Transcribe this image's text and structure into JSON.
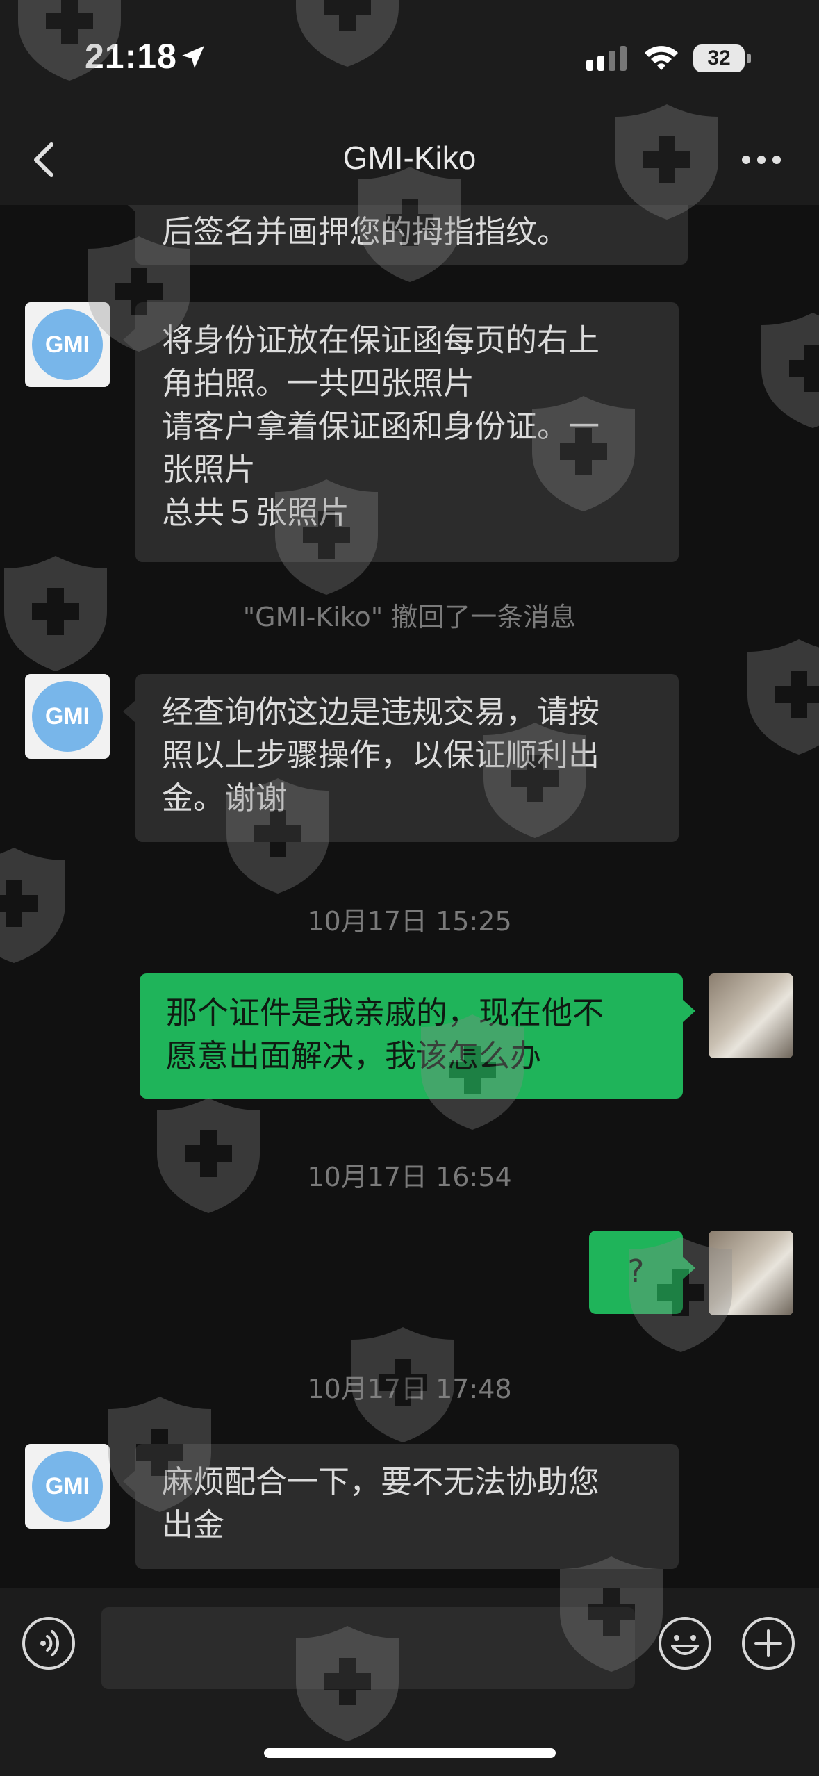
{
  "status": {
    "time": "21:18",
    "battery": "32"
  },
  "nav": {
    "title": "GMI-Kiko"
  },
  "messages": [
    {
      "lines": [
        "后签名并画押您的拇指指纹。"
      ]
    },
    {
      "avatar": "GMI",
      "lines": [
        "将身份证放在保证函每页的右上",
        "角拍照。一共四张照片",
        "请客户拿着保证函和身份证。一",
        "张照片",
        "总共５张照片"
      ]
    },
    {
      "avatar": "GMI",
      "lines": [
        "经查询你这边是违规交易，请按",
        "照以上步骤操作，以保证顺利出",
        "金。谢谢"
      ]
    },
    {
      "lines": [
        "那个证件是我亲戚的，现在他不",
        "愿意出面解决，我该怎么办"
      ]
    },
    {
      "lines": [
        "?"
      ]
    },
    {
      "avatar": "GMI",
      "lines": [
        "麻烦配合一下，要不无法协助您",
        "出金"
      ]
    }
  ],
  "notice": "\"GMI-Kiko\" 撤回了一条消息",
  "timestamps": [
    "10月17日 15:25",
    "10月17日 16:54",
    "10月17日 17:48"
  ]
}
